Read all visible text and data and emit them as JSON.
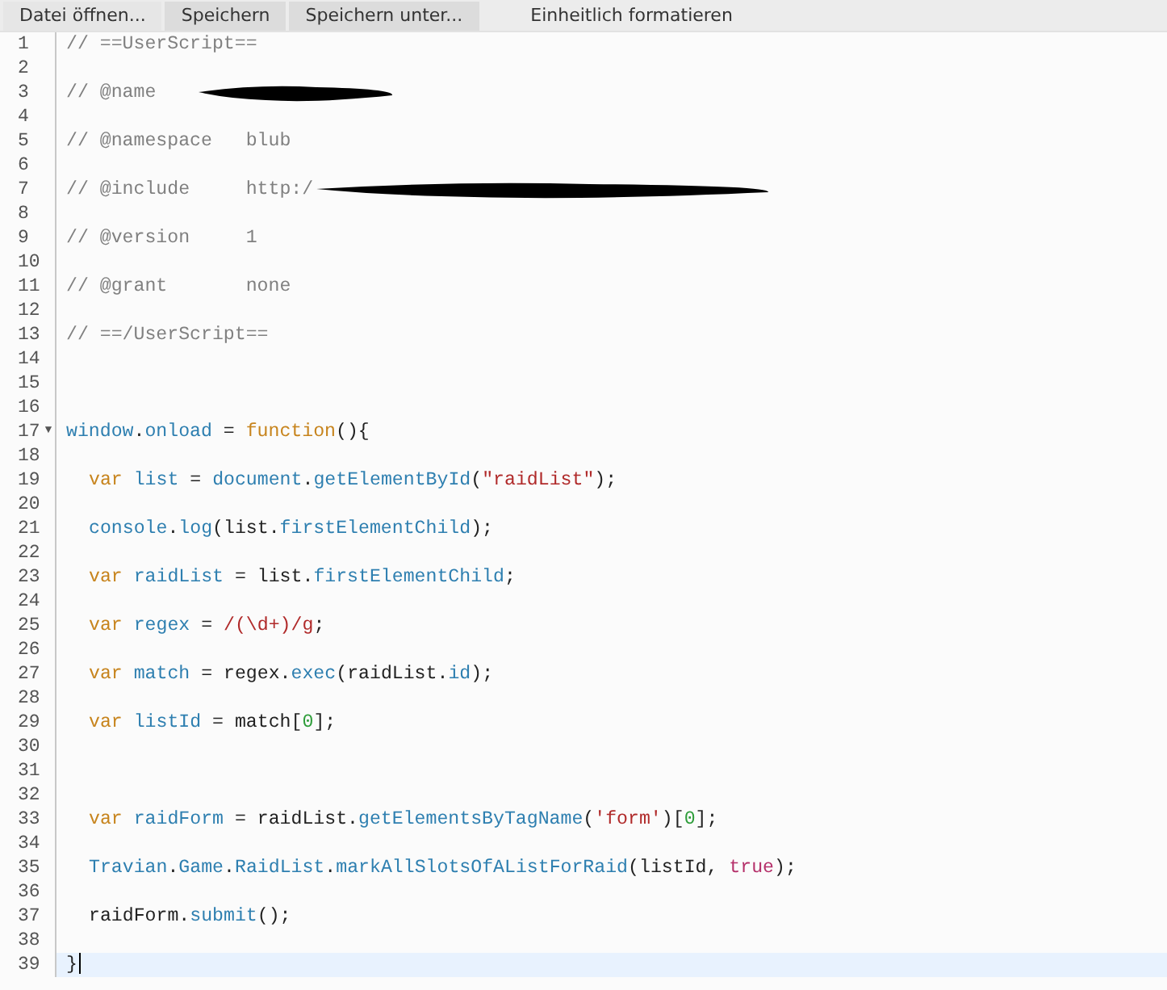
{
  "toolbar": {
    "buttons": [
      {
        "label": "Datei öffnen..."
      },
      {
        "label": "Speichern"
      },
      {
        "label": "Speichern unter..."
      },
      {
        "label": "Einheitlich formatieren"
      }
    ]
  },
  "editor": {
    "lines": [
      {
        "number": "1",
        "tokens": [
          {
            "kind": "comment",
            "text": "// ==UserScript=="
          }
        ]
      },
      {
        "number": "2"
      },
      {
        "number": "3",
        "redacted": true,
        "tokens": [
          {
            "kind": "comment",
            "text": "// @name"
          }
        ]
      },
      {
        "number": "4"
      },
      {
        "number": "5",
        "tokens": [
          {
            "kind": "comment",
            "text": "// @namespace   blub"
          }
        ]
      },
      {
        "number": "6"
      },
      {
        "number": "7",
        "redacted": true,
        "tokens": [
          {
            "kind": "comment",
            "text": "// @include     http:/"
          }
        ]
      },
      {
        "number": "8"
      },
      {
        "number": "9",
        "tokens": [
          {
            "kind": "comment",
            "text": "// @version     1"
          }
        ]
      },
      {
        "number": "10"
      },
      {
        "number": "11",
        "tokens": [
          {
            "kind": "comment",
            "text": "// @grant       none"
          }
        ]
      },
      {
        "number": "12"
      },
      {
        "number": "13",
        "tokens": [
          {
            "kind": "comment",
            "text": "// ==/UserScript=="
          }
        ]
      },
      {
        "number": "14"
      },
      {
        "number": "15"
      },
      {
        "number": "16"
      },
      {
        "number": "17",
        "fold_marker": "▼",
        "tokens": [
          {
            "kind": "variable",
            "text": "window"
          },
          {
            "kind": "plain",
            "text": "."
          },
          {
            "kind": "variable",
            "text": "onload"
          },
          {
            "kind": "plain",
            "text": " = "
          },
          {
            "kind": "keyword",
            "text": "function"
          },
          {
            "kind": "plain",
            "text": "(){"
          }
        ]
      },
      {
        "number": "18"
      },
      {
        "number": "19",
        "indented": true,
        "tokens": [
          {
            "kind": "keyword",
            "text": "var "
          },
          {
            "kind": "variable",
            "text": "list"
          },
          {
            "kind": "plain",
            "text": " = "
          },
          {
            "kind": "variable",
            "text": "document"
          },
          {
            "kind": "plain",
            "text": "."
          },
          {
            "kind": "variable",
            "text": "getElementById"
          },
          {
            "kind": "plain",
            "text": "("
          },
          {
            "kind": "string",
            "text": "\"raidList\""
          },
          {
            "kind": "plain",
            "text": ");"
          }
        ]
      },
      {
        "number": "20"
      },
      {
        "number": "21",
        "indented": true,
        "tokens": [
          {
            "kind": "variable",
            "text": "console"
          },
          {
            "kind": "plain",
            "text": "."
          },
          {
            "kind": "variable",
            "text": "log"
          },
          {
            "kind": "plain",
            "text": "(list."
          },
          {
            "kind": "variable",
            "text": "firstElementChild"
          },
          {
            "kind": "plain",
            "text": ");"
          }
        ]
      },
      {
        "number": "22"
      },
      {
        "number": "23",
        "indented": true,
        "tokens": [
          {
            "kind": "keyword",
            "text": "var "
          },
          {
            "kind": "variable",
            "text": "raidList"
          },
          {
            "kind": "plain",
            "text": " = list."
          },
          {
            "kind": "variable",
            "text": "firstElementChild"
          },
          {
            "kind": "plain",
            "text": ";"
          }
        ]
      },
      {
        "number": "24"
      },
      {
        "number": "25",
        "indented": true,
        "tokens": [
          {
            "kind": "keyword",
            "text": "var "
          },
          {
            "kind": "variable",
            "text": "regex"
          },
          {
            "kind": "plain",
            "text": " = "
          },
          {
            "kind": "string",
            "text": "/(\\d+)/g"
          },
          {
            "kind": "plain",
            "text": ";"
          }
        ]
      },
      {
        "number": "26"
      },
      {
        "number": "27",
        "indented": true,
        "tokens": [
          {
            "kind": "keyword",
            "text": "var "
          },
          {
            "kind": "variable",
            "text": "match"
          },
          {
            "kind": "plain",
            "text": " = regex."
          },
          {
            "kind": "variable",
            "text": "exec"
          },
          {
            "kind": "plain",
            "text": "(raidList."
          },
          {
            "kind": "variable",
            "text": "id"
          },
          {
            "kind": "plain",
            "text": ");"
          }
        ]
      },
      {
        "number": "28"
      },
      {
        "number": "29",
        "indented": true,
        "tokens": [
          {
            "kind": "keyword",
            "text": "var "
          },
          {
            "kind": "variable",
            "text": "listId"
          },
          {
            "kind": "plain",
            "text": " = match["
          },
          {
            "kind": "number",
            "text": "0"
          },
          {
            "kind": "plain",
            "text": "];"
          }
        ]
      },
      {
        "number": "30"
      },
      {
        "number": "31"
      },
      {
        "number": "32"
      },
      {
        "number": "33",
        "indented": true,
        "tokens": [
          {
            "kind": "keyword",
            "text": "var "
          },
          {
            "kind": "variable",
            "text": "raidForm"
          },
          {
            "kind": "plain",
            "text": " = raidList."
          },
          {
            "kind": "variable",
            "text": "getElementsByTagName"
          },
          {
            "kind": "plain",
            "text": "("
          },
          {
            "kind": "string",
            "text": "'form'"
          },
          {
            "kind": "plain",
            "text": ")["
          },
          {
            "kind": "number",
            "text": "0"
          },
          {
            "kind": "plain",
            "text": "];"
          }
        ]
      },
      {
        "number": "34"
      },
      {
        "number": "35",
        "indented": true,
        "tokens": [
          {
            "kind": "variable",
            "text": "Travian"
          },
          {
            "kind": "plain",
            "text": "."
          },
          {
            "kind": "variable",
            "text": "Game"
          },
          {
            "kind": "plain",
            "text": "."
          },
          {
            "kind": "variable",
            "text": "RaidList"
          },
          {
            "kind": "plain",
            "text": "."
          },
          {
            "kind": "variable",
            "text": "markAllSlotsOfAListForRaid"
          },
          {
            "kind": "plain",
            "text": "(listId, "
          },
          {
            "kind": "atom",
            "text": "true"
          },
          {
            "kind": "plain",
            "text": ");"
          }
        ]
      },
      {
        "number": "36"
      },
      {
        "number": "37",
        "indented": true,
        "tokens": [
          {
            "kind": "plain",
            "text": "raidForm."
          },
          {
            "kind": "variable",
            "text": "submit"
          },
          {
            "kind": "plain",
            "text": "();"
          }
        ]
      },
      {
        "number": "38"
      },
      {
        "number": "39",
        "active": true,
        "tokens": [
          {
            "kind": "plain",
            "text": "}"
          }
        ]
      }
    ]
  }
}
